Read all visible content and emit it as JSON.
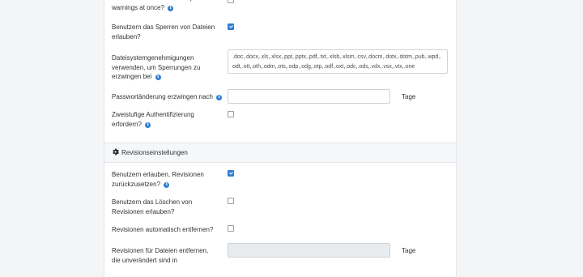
{
  "settings": {
    "resolve_warnings": {
      "label": "Allow users to resolve multiple warnings at once?",
      "checked": false
    },
    "allow_lock": {
      "label": "Benutzern das Sperren von Dateien erlauben?",
      "checked": true
    },
    "fs_permissions": {
      "label": "Dateisystemgenehmigungen verwenden, um Sperrungen zu erzwingen bei",
      "value": ".doc,.docx,.xls,.xlsx,.ppt,.pptx,.pdf,.txt,.xlsb,.xlsm,.csv,.docm,.dotx,.dotm,.pub,.wpd,.odt,.ott,.oth,.odm,.ots,.odp,.odg,.otp,.odf,.oxt,.odc,.ods,.vdx,.vsx,.vtx,.one"
    },
    "password_change": {
      "label": "Passwortänderung erzwingen nach",
      "value": "",
      "unit": "Tage"
    },
    "two_factor": {
      "label": "Zweistufige Authentifizierung erfordern?",
      "checked": false
    }
  },
  "section": {
    "title": "Revisionseinstellungen",
    "icon": "gear-icon"
  },
  "revisions": {
    "allow_reset": {
      "label": "Benutzern erlauben, Revisionen zurückzusetzen?",
      "checked": true
    },
    "allow_delete": {
      "label": "Benutzern das Löschen von Revisionen erlauben?",
      "checked": false
    },
    "auto_remove": {
      "label": "Revisionen automatisch entfernen?",
      "checked": false
    },
    "remove_unchanged": {
      "label": "Revisionen für Dateien entfernen, die unverändert sind in",
      "value": "",
      "unit": "Tage"
    }
  },
  "info_glyph": "i",
  "colors": {
    "accent": "#2f7fd1",
    "panel": "#ffffff",
    "background": "#f4f5f7",
    "section": "#f6f7f8"
  }
}
